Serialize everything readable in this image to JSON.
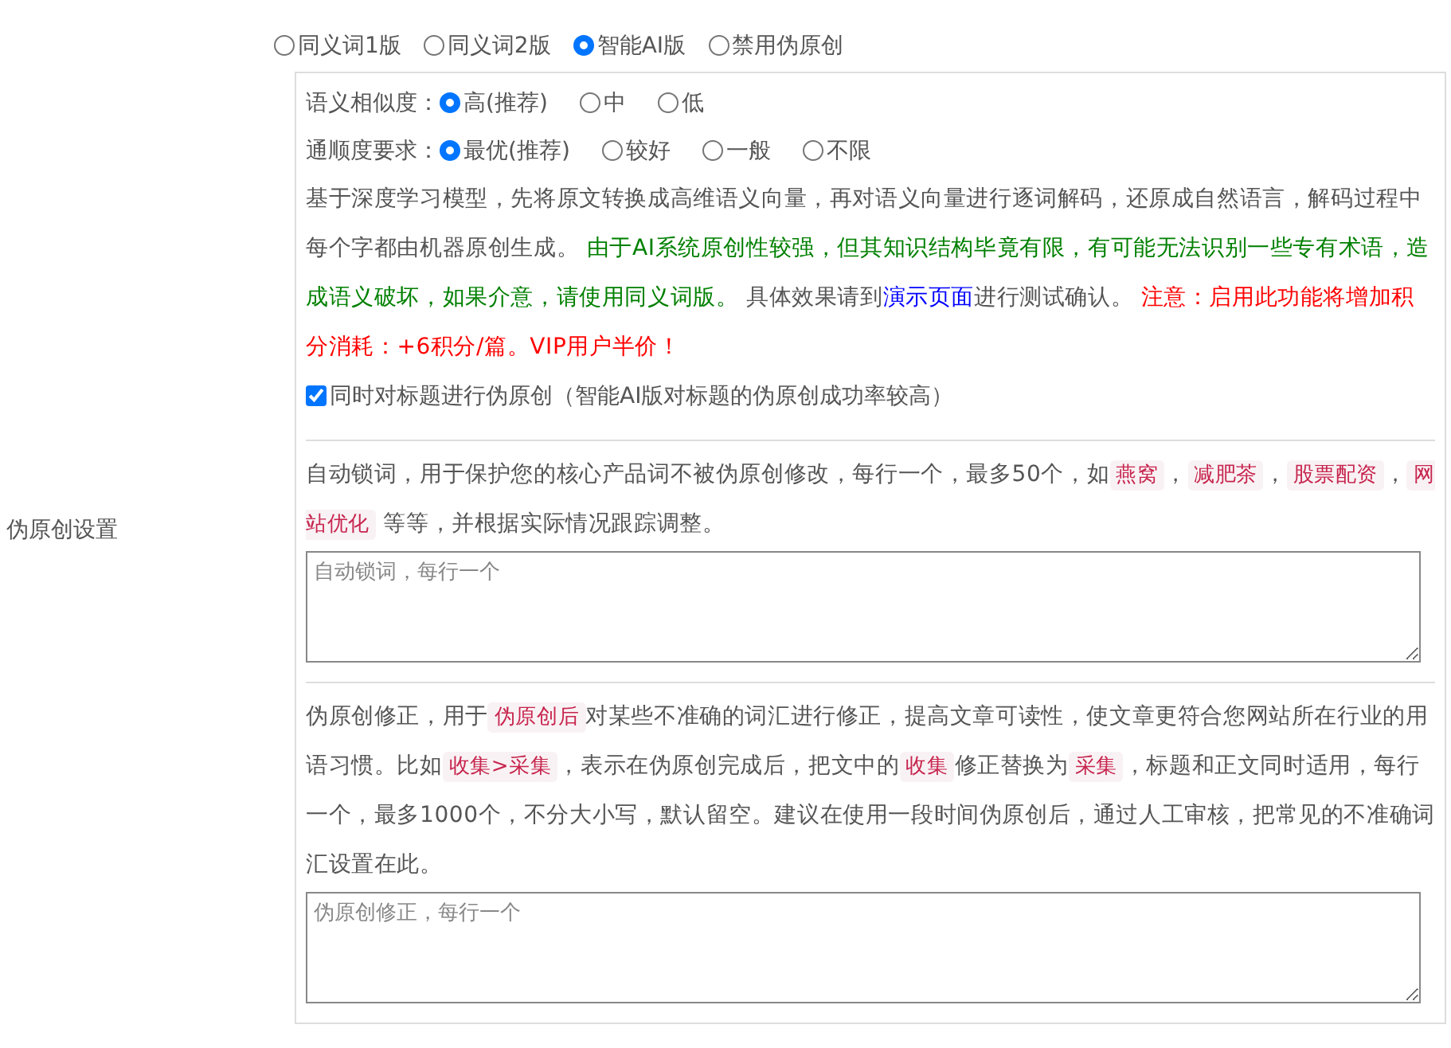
{
  "settings_label": "伪原创设置",
  "modes": [
    {
      "label": "同义词1版",
      "selected": false
    },
    {
      "label": "同义词2版",
      "selected": false
    },
    {
      "label": "智能AI版",
      "selected": true
    },
    {
      "label": "禁用伪原创",
      "selected": false
    }
  ],
  "similarity": {
    "label": "语义相似度：",
    "options": [
      {
        "label": "高(推荐)",
        "selected": true
      },
      {
        "label": "中",
        "selected": false
      },
      {
        "label": "低",
        "selected": false
      }
    ]
  },
  "fluency": {
    "label": "通顺度要求：",
    "options": [
      {
        "label": "最优(推荐)",
        "selected": true
      },
      {
        "label": "较好",
        "selected": false
      },
      {
        "label": "一般",
        "selected": false
      },
      {
        "label": "不限",
        "selected": false
      }
    ]
  },
  "ai_description": [
    {
      "kind": "plain",
      "text": "基于深度学习模型，先将原文转换成高维语义向量，再对语义向量进行逐词解码，还原成自然语言，解码过程中每个字都由机器原创生成。 "
    },
    {
      "kind": "green",
      "text": "由于AI系统原创性较强，但其知识结构毕竟有限，有可能无法识别一些专有术语，造成语义破坏，如果介意，请使用同义词版。"
    },
    {
      "kind": "plain",
      "text": " 具体效果请到"
    },
    {
      "kind": "link",
      "text": "演示页面"
    },
    {
      "kind": "plain",
      "text": "进行测试确认。 "
    },
    {
      "kind": "red",
      "text": "注意：启用此功能将增加积分消耗：+6积分/篇。VIP用户半价！"
    }
  ],
  "title_option": {
    "label": "同时对标题进行伪原创（智能AI版对标题的伪原创成功率较高）",
    "checked": true
  },
  "lock_words": {
    "description": [
      {
        "kind": "plain",
        "text": "自动锁词，用于保护您的核心产品词不被伪原创修改，每行一个，最多50个，如"
      },
      {
        "kind": "tag",
        "text": "燕窝"
      },
      {
        "kind": "plain",
        "text": "，"
      },
      {
        "kind": "tag",
        "text": "减肥茶"
      },
      {
        "kind": "plain",
        "text": "，"
      },
      {
        "kind": "tag",
        "text": "股票配资"
      },
      {
        "kind": "plain",
        "text": "，"
      },
      {
        "kind": "tag",
        "text": "网站优化"
      },
      {
        "kind": "plain",
        "text": " 等等，并根据实际情况跟踪调整。"
      }
    ],
    "placeholder": "自动锁词，每行一个"
  },
  "corrections": {
    "description": [
      {
        "kind": "plain",
        "text": "伪原创修正，用于"
      },
      {
        "kind": "tag",
        "text": "伪原创后"
      },
      {
        "kind": "plain",
        "text": "对某些不准确的词汇进行修正，提高文章可读性，使文章更符合您网站所在行业的用语习惯。比如"
      },
      {
        "kind": "tag",
        "text": "收集>采集"
      },
      {
        "kind": "plain",
        "text": "，表示在伪原创完成后，把文中的"
      },
      {
        "kind": "tag",
        "text": "收集"
      },
      {
        "kind": "plain",
        "text": "修正替换为"
      },
      {
        "kind": "tag",
        "text": "采集"
      },
      {
        "kind": "plain",
        "text": "，标题和正文同时适用，每行一个，最多1000个，不分大小写，默认留空。建议在使用一段时间伪原创后，通过人工审核，把常见的不准确词汇设置在此。"
      }
    ],
    "placeholder": "伪原创修正，每行一个"
  }
}
